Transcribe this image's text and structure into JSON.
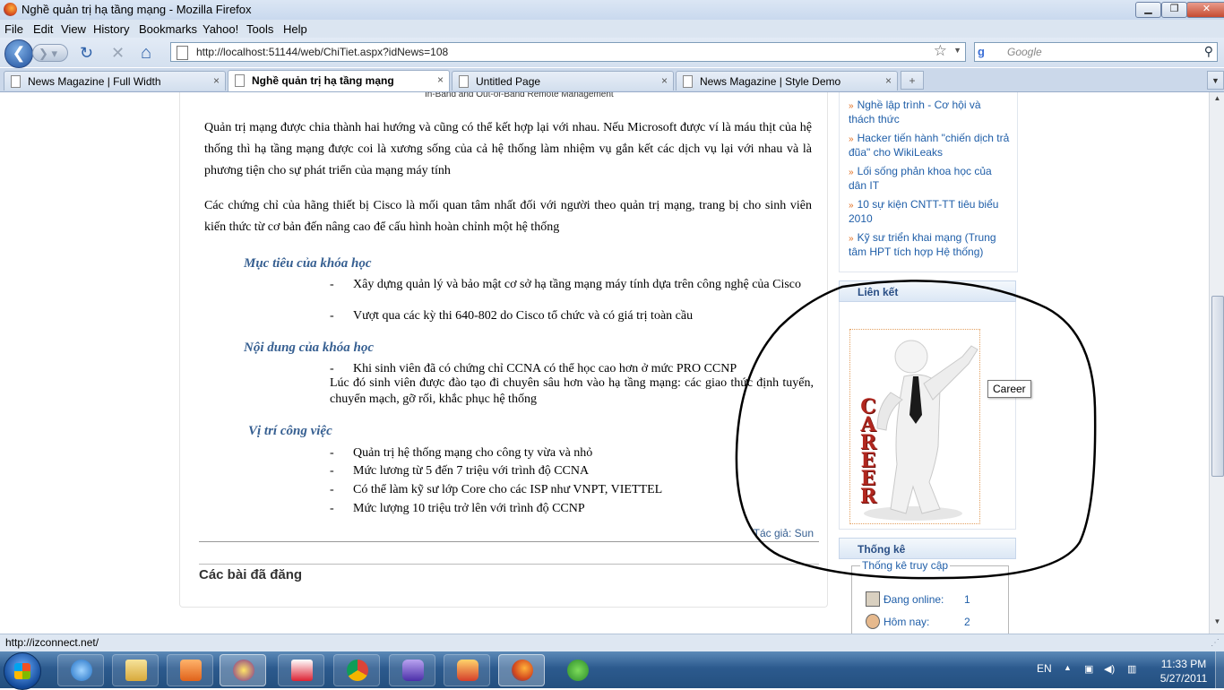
{
  "window": {
    "title": "Nghề quản trị hạ tầng mạng - Mozilla Firefox",
    "btn_min": "▁",
    "btn_max": "❐",
    "btn_close": "✕"
  },
  "menu": [
    "File",
    "Edit",
    "View",
    "History",
    "Bookmarks",
    "Yahoo!",
    "Tools",
    "Help"
  ],
  "nav": {
    "back_glyph": "❮",
    "fwd_glyph": "❯ ▾",
    "reload_glyph": "↻",
    "stop_glyph": "✕",
    "home_glyph": "⌂",
    "url": "http://localhost:51144/web/ChiTiet.aspx?idNews=108",
    "star": "☆",
    "drop": "▼",
    "search_placeholder": "Google",
    "search_engine": "g",
    "search_glyph": "⚲"
  },
  "tabs": [
    {
      "label": "News Magazine | Full Width",
      "active": false
    },
    {
      "label": "Nghề quản trị hạ tầng mạng",
      "active": true
    },
    {
      "label": "Untitled Page",
      "active": false
    },
    {
      "label": "News Magazine | Style Demo",
      "active": false
    }
  ],
  "tab_close": "×",
  "tab_new": "+",
  "tab_list": "▼",
  "article": {
    "caption": "In-Band and Out-of-Band Remote Management",
    "para1": "Quản trị mạng được chia thành hai hướng và cũng có thể kết hợp lại với nhau. Nếu Microsoft được ví là máu thịt của hệ thống thì hạ tầng mạng được coi là xương sống của cả hệ thống làm nhiệm vụ gắn kết các dịch vụ lại  với nhau và là phương tiện cho sự phát triển của mạng máy tính",
    "para2": "Các chứng chỉ của hãng thiết bị Cisco là mối quan tâm nhất đối với người theo quản trị mạng, trang bị cho sinh viên kiến thức từ cơ bản đến nâng cao để cấu hình hoàn chỉnh một hệ thống",
    "dash": "-",
    "sec1_title": "Mục tiêu của khóa học",
    "sec1_items": [
      "Xây dựng quản lý và bảo mật cơ sở hạ tầng mạng máy tính dựa trên công nghệ của Cisco",
      "Vượt qua các kỳ thi 640-802 do Cisco tổ chức và có giá trị toàn cầu"
    ],
    "sec2_title": "Nội dung của khóa học",
    "sec2_item": "Khi sinh viên đã có chứng chỉ CCNA có thể học cao hơn ở mức PRO CCNP",
    "sec2_text": "Lúc đó sinh viên được đào tạo đi chuyên sâu hơn vào hạ tầng mạng: các giao thức định tuyến, chuyển mạch, gỡ rối, khắc phục hệ thống",
    "sec3_title": "Vị trí công việc",
    "sec3_items": [
      "Quản trị hệ thống mạng cho công ty vừa và nhỏ",
      "Mức lương từ 5 đến 7 triệu với trình độ CCNA",
      "Có thể làm kỹ sư lớp Core cho các ISP như VNPT, VIETTEL",
      "Mức lượng 10 triệu trở lên với trình độ CCNP"
    ],
    "author": "Tác giả: Sun",
    "posted_heading": "Các bài đã đăng"
  },
  "sidebar": {
    "news_arrow": "»",
    "news": [
      "Nghề lập trình - Cơ hội và thách thức",
      "Hacker tiến hành \"chiến dịch trả đũa\" cho WikiLeaks",
      "Lối sống phản khoa học của dân IT",
      "10 sự kiện CNTT-TT tiêu biểu 2010",
      "Kỹ sư triển khai mạng (Trung tâm HPT tích hợp Hệ thống)"
    ],
    "links_title": "Liên kết",
    "career_text": "CAREER",
    "tooltip": "Career",
    "stats_title": "Thống kê",
    "stats_legend": "Thống kê truy cập",
    "online_label": "Đang online:",
    "online_value": "1",
    "today_label": "Hôm nay:",
    "today_value": "2"
  },
  "statusbar": {
    "text": "http://izconnect.net/",
    "grip": "⋰"
  },
  "taskbar": {
    "lang": "EN",
    "tray_icons": [
      "▲",
      "▣",
      "◀)",
      "▥"
    ],
    "time": "11:33 PM",
    "date": "5/27/2011",
    "apps": [
      "internet-explorer",
      "windows-explorer",
      "media-player",
      "yahoo-messenger",
      "unikey",
      "chrome",
      "visual-studio",
      "sql-server",
      "firefox",
      "parrot-app"
    ]
  },
  "colors": {
    "link": "#1f5ea8",
    "heading": "#365f91",
    "annotation": "#000000"
  }
}
